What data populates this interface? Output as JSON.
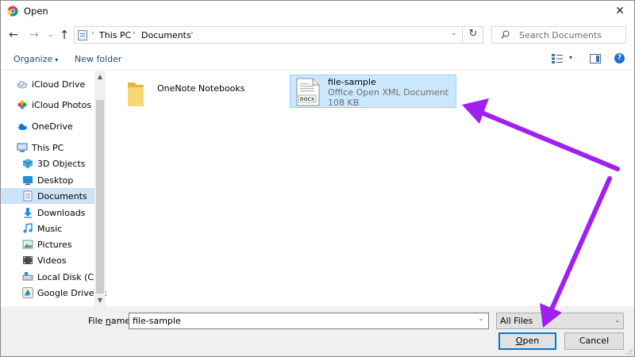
{
  "window": {
    "title": "Open",
    "close_glyph": "✕",
    "app_icon": "chrome-icon"
  },
  "address_bar": {
    "back_glyph": "←",
    "forward_glyph": "→",
    "recent_glyph": "⌄",
    "up_glyph": "↑",
    "breadcrumbs": [
      "This PC",
      "Documents"
    ],
    "separator_glyph": "›",
    "dropdown_glyph": "⌄",
    "refresh_glyph": "↻"
  },
  "search": {
    "placeholder": "Search Documents"
  },
  "toolbar": {
    "organize_label": "Organize",
    "organize_caret": "▾",
    "new_folder_label": "New folder",
    "view_caret": "▾",
    "help_glyph": "?"
  },
  "nav_pane": {
    "items": [
      {
        "label": "iCloud Drive",
        "icon": "icloud-drive-icon"
      },
      {
        "label": "iCloud Photos",
        "icon": "icloud-photos-icon"
      },
      {
        "label": "OneDrive",
        "icon": "onedrive-icon"
      },
      {
        "label": "This PC",
        "icon": "this-pc-icon"
      },
      {
        "label": "3D Objects",
        "icon": "3d-objects-icon"
      },
      {
        "label": "Desktop",
        "icon": "desktop-icon"
      },
      {
        "label": "Documents",
        "icon": "documents-icon",
        "selected": true
      },
      {
        "label": "Downloads",
        "icon": "downloads-icon"
      },
      {
        "label": "Music",
        "icon": "music-icon"
      },
      {
        "label": "Pictures",
        "icon": "pictures-icon"
      },
      {
        "label": "Videos",
        "icon": "videos-icon"
      },
      {
        "label": "Local Disk (C:)",
        "icon": "local-disk-icon"
      },
      {
        "label": "Google Drive (F:)",
        "icon": "google-drive-icon"
      }
    ],
    "scroll_up_glyph": "▲",
    "scroll_down_glyph": "▼"
  },
  "content": {
    "items": [
      {
        "name": "OneNote Notebooks",
        "kind": "folder",
        "icon": "folder-icon"
      },
      {
        "name": "file-sample",
        "kind": "file",
        "icon": "docx-file-icon",
        "icon_badge": "DOCX",
        "type": "Office Open XML Document",
        "size": "108 KB",
        "selected": true
      }
    ]
  },
  "bottom": {
    "file_name_label_prefix": "File ",
    "file_name_label_underlined": "n",
    "file_name_label_suffix": "ame:",
    "file_name_value": "file-sample",
    "file_name_dropdown_glyph": "⌄",
    "filter_value": "All Files",
    "filter_caret": "⌄",
    "open_label_underlined": "O",
    "open_label_rest": "pen",
    "cancel_label": "Cancel"
  },
  "colors": {
    "selection_bg": "#cce8ff",
    "selection_border": "#99d1ff",
    "nav_selected_bg": "#cce4f7",
    "link_blue": "#1a4a86",
    "accent_blue": "#0078d7",
    "annotation_arrow": "#a020f0"
  }
}
